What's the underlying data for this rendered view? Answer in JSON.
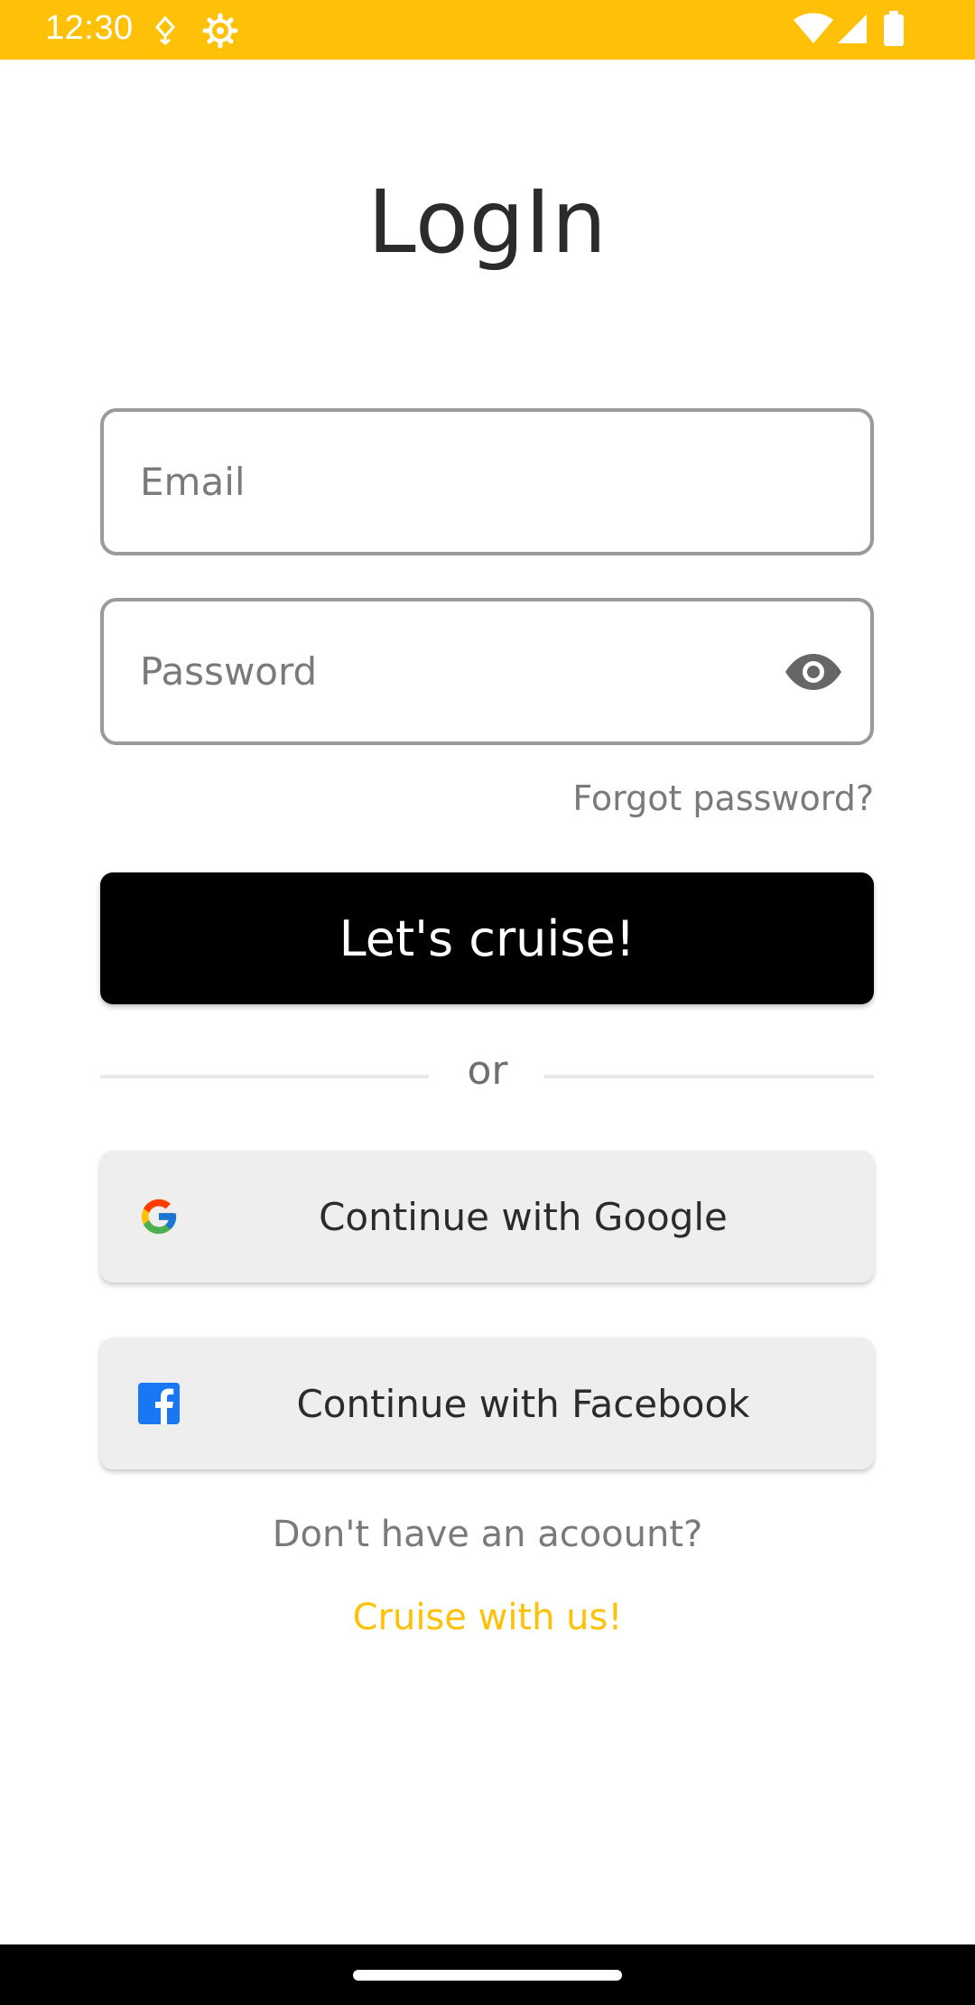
{
  "status_bar": {
    "time": "12:30",
    "background": "#FFC107",
    "icons": [
      "navigation-icon",
      "settings-gear-icon",
      "wifi-icon",
      "cellular-signal-icon",
      "battery-icon"
    ]
  },
  "page": {
    "title": "LogIn"
  },
  "form": {
    "email_placeholder": "Email",
    "password_placeholder": "Password",
    "forgot_password": "Forgot password?",
    "submit_label": "Let's cruise!"
  },
  "divider": {
    "text": "or"
  },
  "social": {
    "google_label": "Continue with Google",
    "facebook_label": "Continue with Facebook"
  },
  "signup": {
    "prompt": "Don't have an acoount?",
    "link": "Cruise with us!"
  },
  "colors": {
    "accent": "#FFC107",
    "primary_button": "#000000",
    "social_button": "#EEEEEE",
    "facebook_blue": "#1877F2"
  }
}
